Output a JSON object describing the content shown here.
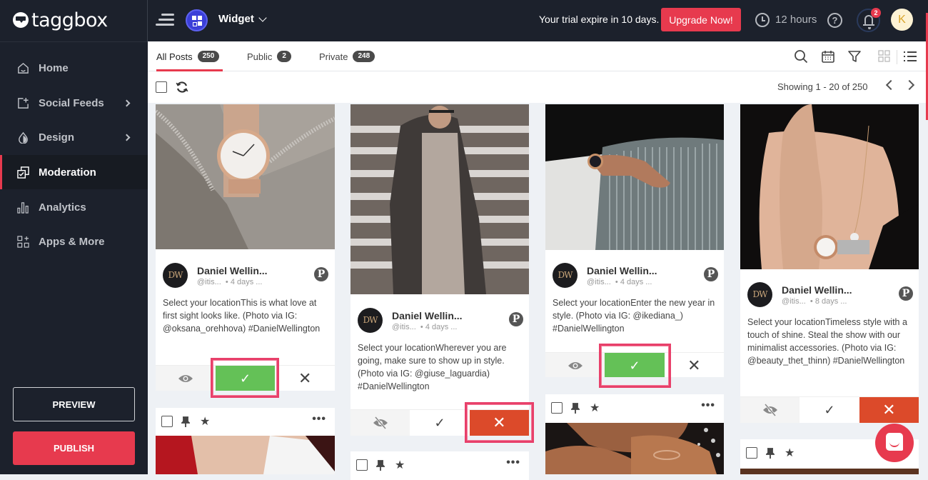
{
  "app": {
    "brand": "taggbox",
    "widget_label": "Widget"
  },
  "header": {
    "trial_text": "Your trial expire in 10 days.",
    "upgrade_label": "Upgrade Now!",
    "time_remaining": "12 hours",
    "help_glyph": "?",
    "notification_count": "2",
    "user_initial": "K"
  },
  "sidebar": {
    "items": [
      {
        "label": "Home",
        "icon": "home-icon"
      },
      {
        "label": "Social Feeds",
        "icon": "add-feed-icon",
        "has_submenu": true
      },
      {
        "label": "Design",
        "icon": "droplet-icon",
        "has_submenu": true
      },
      {
        "label": "Moderation",
        "icon": "moderation-icon",
        "active": true
      },
      {
        "label": "Analytics",
        "icon": "bar-chart-icon"
      },
      {
        "label": "Apps & More",
        "icon": "apps-icon"
      }
    ],
    "preview_label": "PREVIEW",
    "publish_label": "PUBLISH"
  },
  "tabs": [
    {
      "label": "All Posts",
      "count": "250",
      "active": true
    },
    {
      "label": "Public",
      "count": "2"
    },
    {
      "label": "Private",
      "count": "248"
    }
  ],
  "pagination": {
    "text": "Showing 1 - 20 of 250"
  },
  "posts": [
    {
      "author": "Daniel Wellin...",
      "handle": "@itis...",
      "time": "• 4 days ...",
      "avatar_text": "DW",
      "text": "Select your locationThis is what love at first sight looks like. (Photo via IG: @oksana_orehhova) #DanielWellington",
      "status": "public",
      "highlighted_action": "approve"
    },
    {
      "author": "Daniel Wellin...",
      "handle": "@itis...",
      "time": "• 4 days ...",
      "avatar_text": "DW",
      "text": "Select your locationWherever you are going, make sure to show up in style. (Photo via IG: @giuse_laguardia) #DanielWellington",
      "status": "private",
      "highlighted_action": "reject"
    },
    {
      "author": "Daniel Wellin...",
      "handle": "@itis...",
      "time": "• 4 days ...",
      "avatar_text": "DW",
      "text": "Select your locationEnter the new year in style. (Photo via IG: @ikediana_) #DanielWellington",
      "status": "public",
      "highlighted_action": "approve"
    },
    {
      "author": "Daniel Wellin...",
      "handle": "@itis...",
      "time": "• 8 days ...",
      "avatar_text": "DW",
      "text": "Select your locationTimeless style with a touch of shine. Steal the show with our minimalist accessories. (Photo via IG: @beauty_thet_thinn) #DanielWellington",
      "status": "private",
      "highlighted_action": null
    }
  ],
  "glyphs": {
    "check": "✓",
    "close": "✕",
    "more": "•••",
    "star": "★",
    "pin": "📌",
    "pinterest": "P"
  },
  "colors": {
    "accent": "#e73a4e",
    "approve": "#64c157",
    "reject": "#dc4a2a",
    "sidebar_bg": "#1c212c",
    "highlight": "#e8406a"
  }
}
